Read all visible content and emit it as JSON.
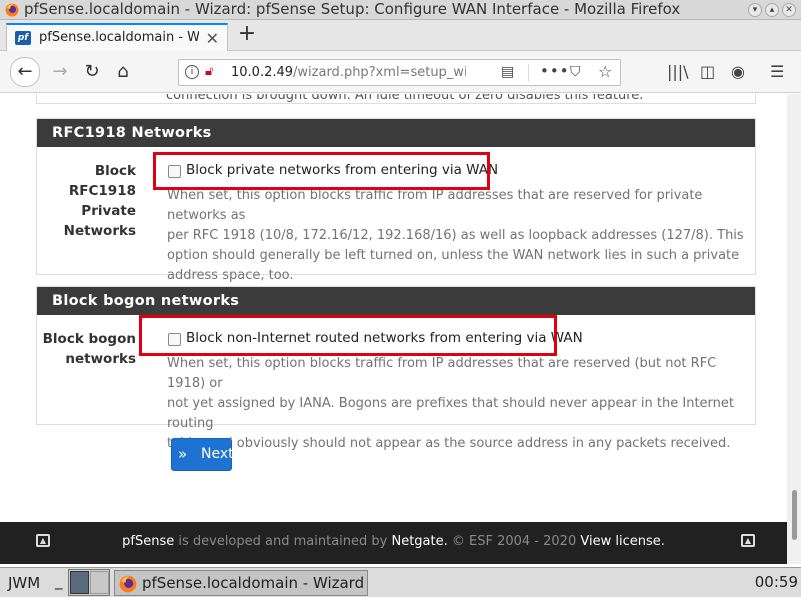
{
  "window": {
    "title": "pfSense.localdomain - Wizard: pfSense Setup: Configure WAN Interface - Mozilla Firefox"
  },
  "browser": {
    "tab_title": "pfSense.localdomain - Wiz",
    "new_tab": "+",
    "url_host": "10.0.2.49",
    "url_path": "/wizard.php?xml=setup_wiz"
  },
  "page": {
    "truncated_text": "connection is brought down. An idle timeout of zero disables this feature.",
    "rfc1918": {
      "heading": "RFC1918 Networks",
      "label_lines": [
        "Block",
        "RFC1918",
        "Private",
        "Networks"
      ],
      "checkbox_label": "Block private networks from entering via WAN",
      "checked": false,
      "help_lines": [
        "When set, this option blocks traffic from IP addresses that are reserved for private networks as",
        "per RFC 1918 (10/8, 172.16/12, 192.168/16) as well as loopback addresses (127/8). This",
        "option should generally be left turned on, unless the WAN network lies in such a private",
        "address space, too."
      ]
    },
    "bogon": {
      "heading": "Block bogon networks",
      "label_lines": [
        "Block bogon",
        "networks"
      ],
      "checkbox_label": "Block non-Internet routed networks from entering via WAN",
      "checked": false,
      "help_lines": [
        "When set, this option blocks traffic from IP addresses that are reserved (but not RFC 1918) or",
        "not yet assigned by IANA. Bogons are prefixes that should never appear in the Internet routing",
        "table, and obviously should not appear as the source address in any packets received."
      ]
    },
    "next_button": "Next",
    "footer": {
      "brand": "pfSense",
      "middle": " is developed and maintained by ",
      "company": "Netgate.",
      "copyright": " © ESF 2004 - 2020 ",
      "license": "View license."
    }
  },
  "taskbar": {
    "wm_label": "JWM",
    "underscore": "_",
    "task_label": "pfSense.localdomain - Wizard",
    "clock": "00:59"
  },
  "colors": {
    "highlight": "#e00010",
    "panel_header": "#3b3b3b",
    "primary_button": "#1e73d2"
  }
}
